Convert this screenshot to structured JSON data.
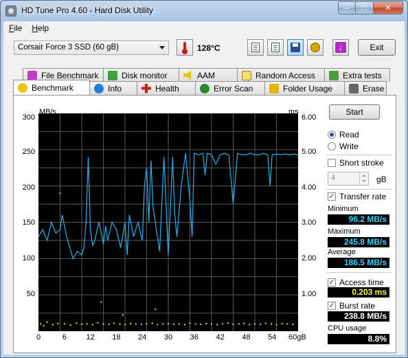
{
  "window": {
    "title": "HD Tune Pro 4.60 - Hard Disk Utility",
    "minimize": "–",
    "maximize": "□",
    "close": "✕"
  },
  "menu": [
    {
      "underline": "F",
      "rest": "ile"
    },
    {
      "underline": "H",
      "rest": "elp"
    }
  ],
  "toolbar": {
    "drive": "Corsair Force 3 SSD (60 gB)",
    "temperature": "128°C",
    "exit_label": "Exit",
    "icons": [
      "copy-text-icon",
      "copy-screenshot-icon",
      "save-icon",
      "options-icon",
      "download-icon"
    ]
  },
  "tabs_row1": [
    {
      "label": "File Benchmark",
      "icon": "file-benchmark-icon"
    },
    {
      "label": "Disk monitor",
      "icon": "disk-monitor-icon"
    },
    {
      "label": "AAM",
      "icon": "speaker-icon"
    },
    {
      "label": "Random Access",
      "icon": "random-access-icon"
    },
    {
      "label": "Extra tests",
      "icon": "extra-tests-icon"
    }
  ],
  "tabs_row2": [
    {
      "label": "Benchmark",
      "icon": "benchmark-icon",
      "selected": true
    },
    {
      "label": "Info",
      "icon": "info-icon"
    },
    {
      "label": "Health",
      "icon": "health-icon"
    },
    {
      "label": "Error Scan",
      "icon": "error-scan-icon"
    },
    {
      "label": "Folder Usage",
      "icon": "folder-icon"
    },
    {
      "label": "Erase",
      "icon": "erase-icon"
    }
  ],
  "chart": {
    "y_unit": "MB/s",
    "y2_unit": "ms",
    "y_ticks": [
      "300",
      "250",
      "200",
      "150",
      "100",
      "50"
    ],
    "y2_ticks": [
      "6.00",
      "5.00",
      "4.00",
      "3.00",
      "2.00",
      "1.00"
    ],
    "x_ticks": [
      "0",
      "6",
      "12",
      "18",
      "24",
      "30",
      "36",
      "42",
      "48",
      "54",
      "60gB"
    ]
  },
  "chart_data": {
    "type": "line",
    "xlabel": "",
    "ylabel": "MB/s",
    "y2label": "ms",
    "xlim": [
      0,
      60
    ],
    "ylim": [
      0,
      300
    ],
    "y2lim": [
      0,
      6
    ],
    "series": [
      {
        "color": "#2aa6e0",
        "x": [
          0,
          1,
          2,
          3,
          4,
          5,
          5.5,
          6,
          6.5,
          7,
          8,
          9,
          10,
          10.5,
          11,
          11.5,
          12,
          12.5,
          13,
          14,
          15,
          15.5,
          16,
          17,
          18,
          19,
          20,
          20.5,
          21,
          22,
          23,
          24,
          24.5,
          25,
          25.5,
          26,
          26.5,
          27,
          28,
          28.5,
          29,
          30,
          30.5,
          31,
          31.5,
          32,
          33,
          34,
          35,
          35.5,
          36,
          37,
          38,
          38.5,
          39,
          40,
          41,
          42,
          43,
          44,
          45,
          46,
          47,
          48,
          49,
          50,
          51,
          52,
          53,
          53.5,
          54,
          55,
          56,
          57,
          58,
          59,
          60
        ],
        "y": [
          130,
          140,
          125,
          150,
          135,
          140,
          160,
          145,
          130,
          120,
          100,
          110,
          105,
          115,
          150,
          240,
          140,
          118,
          125,
          150,
          120,
          145,
          125,
          150,
          140,
          115,
          150,
          105,
          160,
          130,
          150,
          125,
          200,
          225,
          150,
          235,
          170,
          150,
          110,
          175,
          240,
          105,
          170,
          240,
          160,
          130,
          200,
          245,
          180,
          130,
          245,
          243,
          245,
          215,
          245,
          243,
          230,
          243,
          245,
          243,
          175,
          245,
          243,
          243,
          245,
          243,
          243,
          245,
          243,
          200,
          243,
          244,
          243,
          244,
          243,
          244,
          243
        ]
      },
      {
        "color": "#e8e800",
        "name": "access time",
        "scatter": true,
        "x": [
          0.5,
          1.2,
          2,
          3.3,
          4.5,
          6,
          7.4,
          8.8,
          10,
          11.2,
          12.5,
          13.7,
          15,
          16.3,
          17.5,
          18.8,
          20,
          21.3,
          22.5,
          23.8,
          25,
          26.3,
          27.5,
          28.8,
          30,
          31.3,
          32.5,
          33.8,
          35,
          36.3,
          37.5,
          38.8,
          40,
          41.3,
          42.5,
          43.8,
          45,
          46.3,
          47.5,
          48.8,
          50,
          51.3,
          52.5,
          53.8,
          55,
          56.3,
          57.5,
          58.8,
          14.5,
          19.5,
          5,
          27
        ],
        "y": [
          0.2,
          0.15,
          0.25,
          0.18,
          0.21,
          0.2,
          0.17,
          0.22,
          0.19,
          0.2,
          0.18,
          0.23,
          0.2,
          0.19,
          0.22,
          0.2,
          0.18,
          0.21,
          0.2,
          0.19,
          0.2,
          0.22,
          0.18,
          0.2,
          0.21,
          0.19,
          0.2,
          0.18,
          0.22,
          0.2,
          0.19,
          0.21,
          0.2,
          0.18,
          0.2,
          0.22,
          0.19,
          0.2,
          0.21,
          0.18,
          0.2,
          0.19,
          0.22,
          0.2,
          0.18,
          0.21,
          0.2,
          0.19,
          0.8,
          0.45,
          3.8,
          0.6
        ]
      }
    ]
  },
  "controls": {
    "start_label": "Start",
    "read_label": "Read",
    "write_label": "Write",
    "read_selected": true,
    "short_stroke_label": "Short stroke",
    "short_stroke_checked": false,
    "stroke_value": "4",
    "stroke_unit": "gB",
    "transfer_rate_label": "Transfer rate",
    "transfer_rate_checked": true,
    "access_time_label": "Access time",
    "access_time_checked": true,
    "burst_rate_label": "Burst rate",
    "burst_rate_checked": true
  },
  "stats": {
    "minimum_label": "Minimum",
    "minimum_value": "96.2 MB/s",
    "maximum_label": "Maximum",
    "maximum_value": "245.8 MB/s",
    "average_label": "Average",
    "average_value": "186.5 MB/s",
    "access_time_value": "0.203 ms",
    "burst_rate_value": "238.8 MB/s",
    "cpu_usage_label": "CPU usage",
    "cpu_usage_value": "8.8%"
  }
}
